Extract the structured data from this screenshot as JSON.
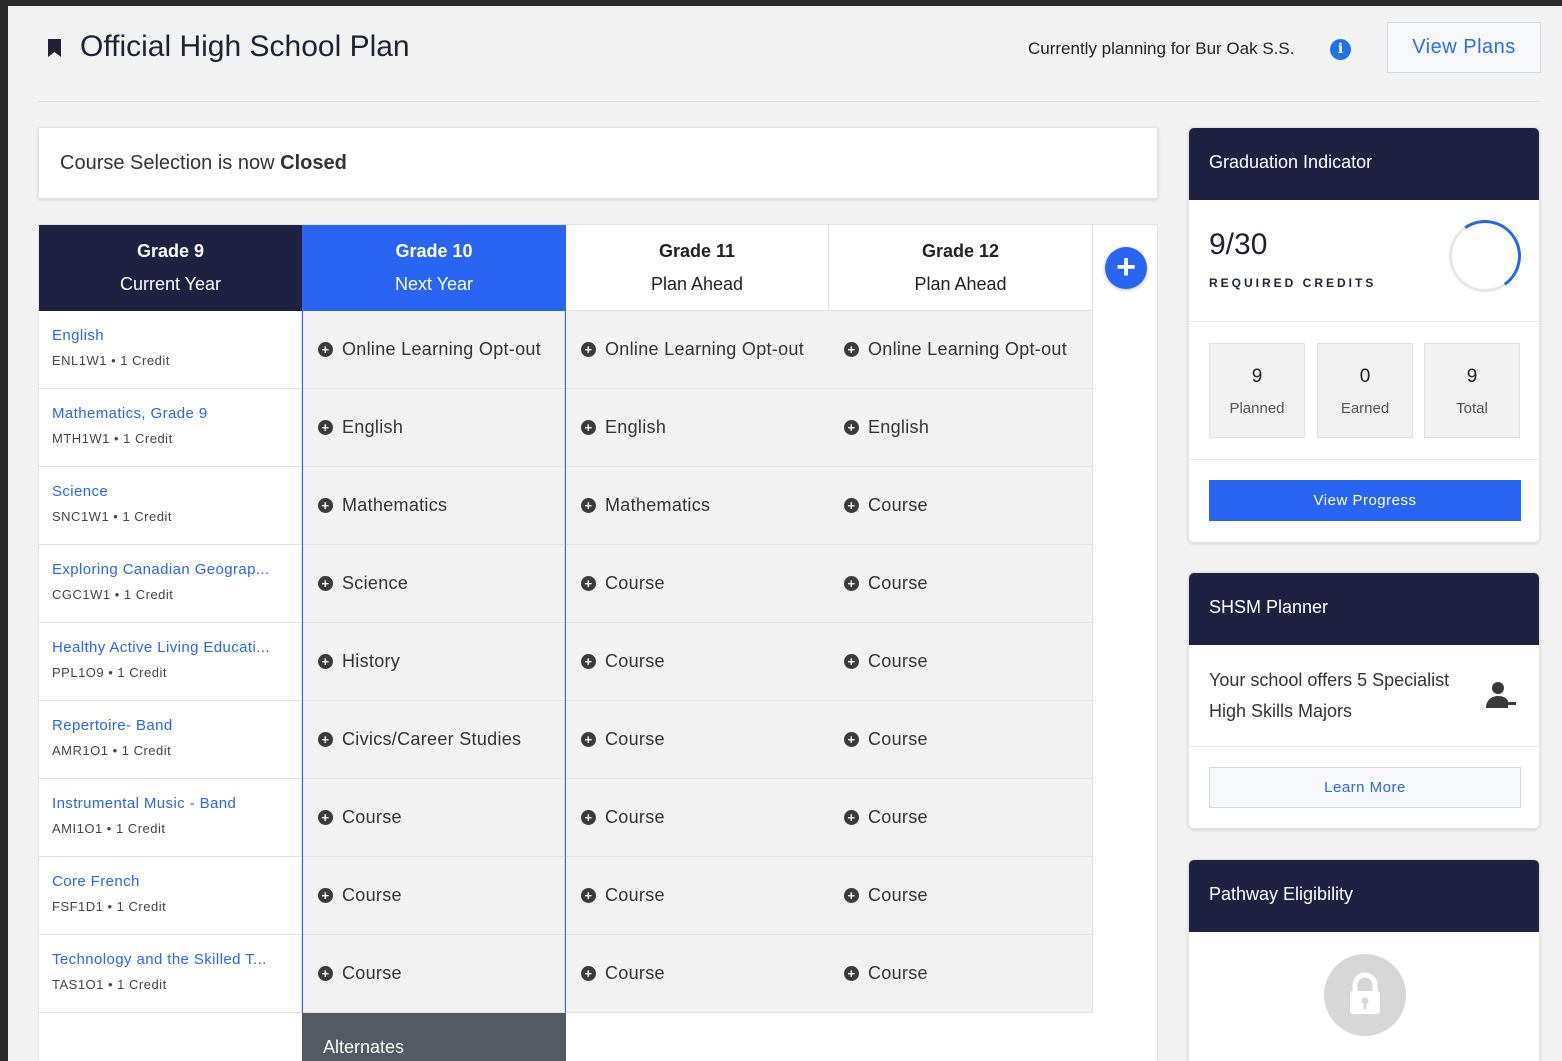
{
  "header": {
    "title": "Official High School Plan",
    "planning_text": "Currently planning for Bur Oak S.S.",
    "view_plans_label": "View Plans"
  },
  "banner": {
    "prefix": "Course Selection is now",
    "status": "Closed"
  },
  "grades": [
    {
      "grade": "Grade 9",
      "subtitle": "Current Year"
    },
    {
      "grade": "Grade 10",
      "subtitle": "Next Year"
    },
    {
      "grade": "Grade 11",
      "subtitle": "Plan Ahead"
    },
    {
      "grade": "Grade 12",
      "subtitle": "Plan Ahead"
    }
  ],
  "grade9_courses": [
    {
      "name": "English",
      "code": "ENL1W1 • 1 Credit"
    },
    {
      "name": "Mathematics, Grade 9",
      "code": "MTH1W1 • 1 Credit"
    },
    {
      "name": "Science",
      "code": "SNC1W1 • 1 Credit"
    },
    {
      "name": "Exploring Canadian Geograp...",
      "code": "CGC1W1 • 1 Credit"
    },
    {
      "name": "Healthy Active Living Educati...",
      "code": "PPL1O9 • 1 Credit"
    },
    {
      "name": "Repertoire- Band",
      "code": "AMR1O1 • 1 Credit"
    },
    {
      "name": "Instrumental Music - Band",
      "code": "AMI1O1 • 1 Credit"
    },
    {
      "name": "Core French",
      "code": "FSF1D1 • 1 Credit"
    },
    {
      "name": "Technology and the Skilled T...",
      "code": "TAS1O1 • 1 Credit"
    }
  ],
  "grade10_slots": [
    "Online Learning Opt-out",
    "English",
    "Mathematics",
    "Science",
    "History",
    "Civics/Career Studies",
    "Course",
    "Course",
    "Course"
  ],
  "grade11_slots": [
    "Online Learning Opt-out",
    "English",
    "Mathematics",
    "Course",
    "Course",
    "Course",
    "Course",
    "Course",
    "Course"
  ],
  "grade12_slots": [
    "Online Learning Opt-out",
    "English",
    "Course",
    "Course",
    "Course",
    "Course",
    "Course",
    "Course",
    "Course"
  ],
  "alternates_label": "Alternates",
  "graduation": {
    "title": "Graduation Indicator",
    "credits": "9/30",
    "credits_label": "REQUIRED CREDITS",
    "progress_fraction": 0.3,
    "stats": [
      {
        "value": "9",
        "label": "Planned"
      },
      {
        "value": "0",
        "label": "Earned"
      },
      {
        "value": "9",
        "label": "Total"
      }
    ],
    "view_progress_label": "View Progress"
  },
  "shsm": {
    "title": "SHSM Planner",
    "text": "Your school offers 5 Specialist High Skills Majors",
    "learn_more_label": "Learn More"
  },
  "pathway": {
    "title": "Pathway Eligibility"
  },
  "colors": {
    "navy": "#1f2143",
    "accent_blue": "#2a64f2"
  }
}
